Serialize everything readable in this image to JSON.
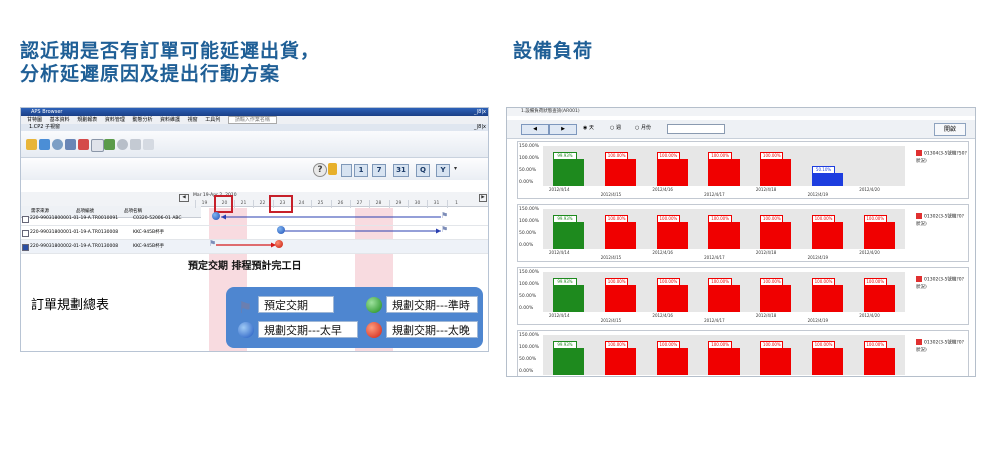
{
  "headings": {
    "left_line1": "認近期是否有訂單可能延遲出貨，",
    "left_line2": "分析延遲原因及提出行動方案",
    "right": "設備負荷"
  },
  "aps": {
    "title": "APS Browser",
    "window_controls": "_|8|x",
    "menu": [
      "甘特圖",
      "基本資料",
      "規劃報表",
      "資料管理",
      "動態分析",
      "資料維護",
      "視窗",
      "工具列",
      "請輸入作業名稱"
    ],
    "subwindow": "1.CP2 子視窗",
    "date_header": "Mar 19-Apr 2, 2010",
    "toolbar2_buttons": [
      "1",
      "7",
      "31",
      "Q",
      "Y"
    ],
    "columns": [
      "需求來源",
      "品項編號",
      "品項名稱"
    ],
    "days": [
      "19",
      "20",
      "21",
      "22",
      "23",
      "24",
      "25",
      "26",
      "27",
      "28",
      "29",
      "30",
      "31",
      "1"
    ],
    "rows": [
      {
        "source": "220-99031800001-0",
        "item_no": "1-19-A.TR0010091",
        "item_name": "C0320-52006-01 ABC"
      },
      {
        "source": "220-99031800001-0",
        "item_no": "1-19-A.TR0130008",
        "item_name": "KKC-945B杯手"
      },
      {
        "source": "220-99031800002-0",
        "item_no": "1-19-A.TR0130008",
        "item_name": "KKC-945B杯手"
      }
    ],
    "annotation": "預定交期  排程預計完工日",
    "summary_label": "訂單規劃總表",
    "legend": {
      "planned": "預定交期",
      "on_time": "規劃交期---準時",
      "early": "規劃交期---太早",
      "late": "規劃交期---太晚"
    },
    "colors": {
      "early": "#2a6fd1",
      "late": "#e03b1f",
      "on_time": "#2aa02a",
      "legend_bg": "#4e86d0"
    }
  },
  "res": {
    "title": "1.設備負荷狀態查詢(AR001)",
    "radios": [
      "天",
      "週",
      "月份"
    ],
    "print_label": "開啟",
    "dates_a": [
      "2012/4/14",
      "2012/4/16",
      "2012/4/18",
      "2012/4/20"
    ],
    "dates_b": [
      "2012/4/15",
      "2012/4/17",
      "2012/4/19"
    ]
  },
  "chart_data": [
    {
      "type": "bar",
      "series": [
        {
          "name": "01304(3-5號機?50?狀況)",
          "values": [
            99.93,
            100,
            100,
            100,
            100,
            50.1
          ]
        }
      ],
      "ylabels": [
        "150.00%",
        "100.00%",
        "50.00%",
        "0.00%"
      ],
      "value_labels": [
        "99.93%",
        "100.00%",
        "100.00%",
        "100.00%",
        "100.00%",
        "50.10%"
      ],
      "colors": [
        "#1e8a1e",
        "#f00000",
        "#f00000",
        "#f00000",
        "#f00000",
        "#1d3ddf"
      ]
    },
    {
      "type": "bar",
      "series": [
        {
          "name": "01302(3-5號機?0?狀況)",
          "values": [
            99.93,
            100,
            100,
            100,
            100,
            100,
            100
          ]
        }
      ],
      "ylabels": [
        "150.00%",
        "100.00%",
        "50.00%",
        "0.00%"
      ],
      "value_labels": [
        "99.93%",
        "100.00%",
        "100.00%",
        "100.00%",
        "100.00%",
        "100.00%",
        "100.00%"
      ],
      "colors": [
        "#1e8a1e",
        "#f00000",
        "#f00000",
        "#f00000",
        "#f00000",
        "#f00000",
        "#f00000"
      ]
    },
    {
      "type": "bar",
      "series": [
        {
          "name": "01302(3-5號機?0?狀況)",
          "values": [
            99.93,
            100,
            100,
            100,
            100,
            100,
            100
          ]
        }
      ],
      "ylabels": [
        "150.00%",
        "100.00%",
        "50.00%",
        "0.00%"
      ],
      "value_labels": [
        "99.93%",
        "100.00%",
        "100.00%",
        "100.00%",
        "100.00%",
        "100.00%",
        "100.00%"
      ],
      "colors": [
        "#1e8a1e",
        "#f00000",
        "#f00000",
        "#f00000",
        "#f00000",
        "#f00000",
        "#f00000"
      ]
    },
    {
      "type": "bar",
      "series": [
        {
          "name": "01302(3-5號機?0?狀況)",
          "values": [
            99.93,
            100,
            100,
            100,
            100,
            100,
            100
          ]
        }
      ],
      "ylabels": [
        "150.00%",
        "100.00%",
        "50.00%",
        "0.00%"
      ],
      "value_labels": [
        "99.93%",
        "100.00%",
        "100.00%",
        "100.00%",
        "100.00%",
        "100.00%",
        "100.00%"
      ],
      "colors": [
        "#1e8a1e",
        "#f00000",
        "#f00000",
        "#f00000",
        "#f00000",
        "#f00000",
        "#f00000"
      ]
    }
  ]
}
